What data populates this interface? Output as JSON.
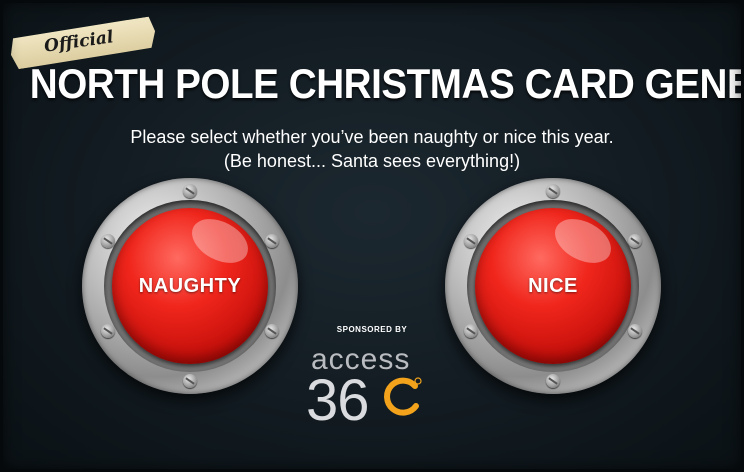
{
  "badge": {
    "label": "Official"
  },
  "header": {
    "title": "NORTH POLE CHRISTMAS CARD GENERATOR",
    "subtitle": "Please select whether you’ve been naughty or nice this year.",
    "subtitle2": "(Be honest... Santa sees everything!)"
  },
  "buttons": {
    "naughty": "NAUGHTY",
    "nice": "NICE"
  },
  "sponsor": {
    "label": "SPONSORED BY",
    "logo_word": "access",
    "logo_number": "36"
  },
  "colors": {
    "background": "#121b21",
    "button_red": "#e81c14",
    "logo_orange": "#f2a31b",
    "logo_grey": "#b9bcc0"
  }
}
